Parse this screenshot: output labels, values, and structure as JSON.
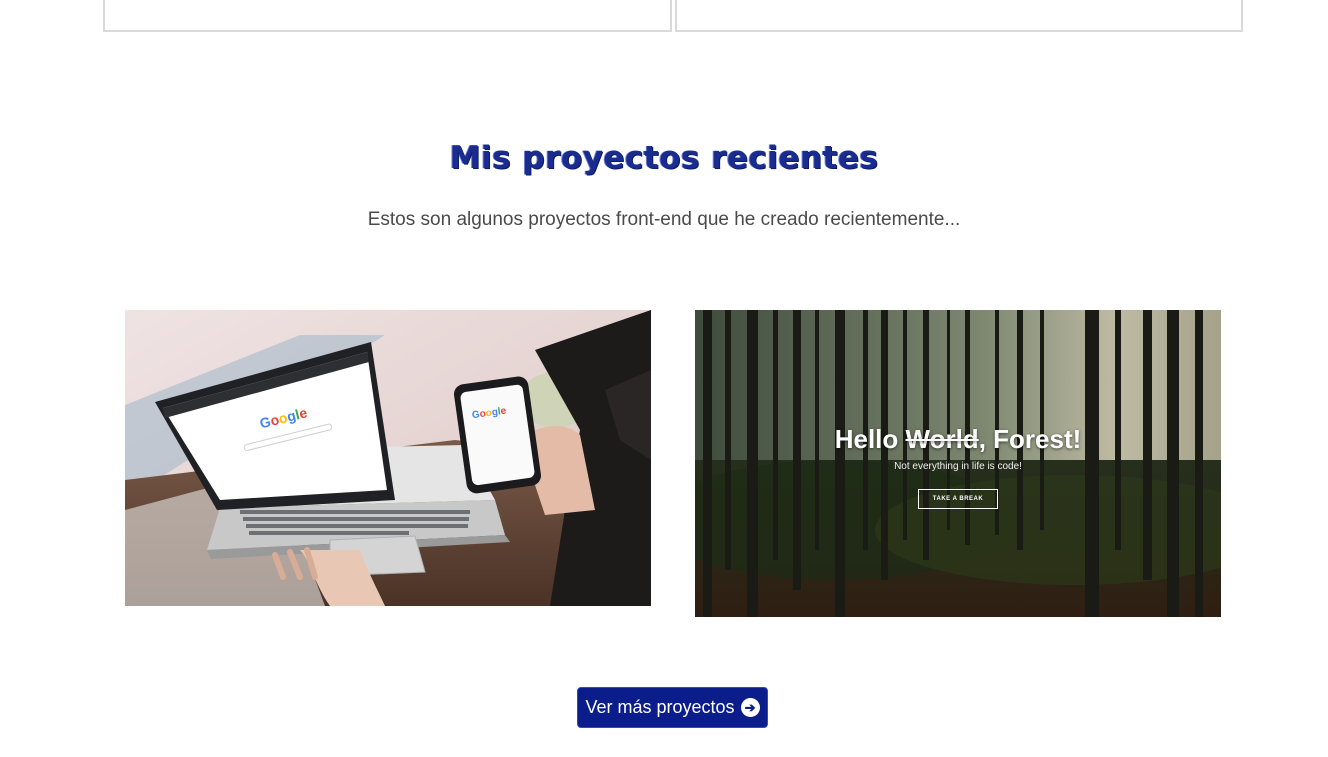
{
  "projects_section": {
    "title": "Mis proyectos recientes",
    "subtitle": "Estos son algunos proyectos front-end que he creado recientemente...",
    "projects": [
      {
        "image": "laptop-google-search-image",
        "screen_logo": "Google",
        "phone_logo": "Google"
      },
      {
        "image": "forest-landing-page-image",
        "heading_prefix": "Hello ",
        "heading_strike": "World",
        "heading_suffix": ", Forest!",
        "tagline": "Not everything in life is code!",
        "cta_label": "TAKE A BREAK"
      }
    ],
    "more_button": {
      "label": "Ver más proyectos",
      "icon": "arrow-right-circle-icon"
    }
  },
  "colors": {
    "title": "#1a2d8f",
    "button_bg": "#0a1d8a",
    "card_border": "#d9d9d9"
  }
}
